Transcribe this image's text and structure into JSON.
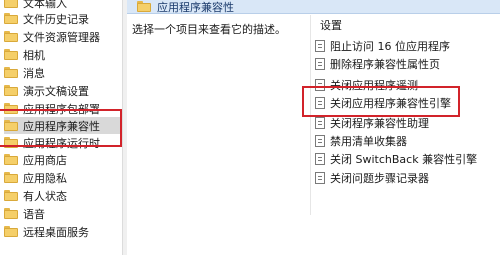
{
  "tree": {
    "items": [
      {
        "label": "文本输入"
      },
      {
        "label": "文件历史记录"
      },
      {
        "label": "文件资源管理器"
      },
      {
        "label": "相机"
      },
      {
        "label": "消息"
      },
      {
        "label": "演示文稿设置"
      },
      {
        "label": "应用程序包部署"
      },
      {
        "label": "应用程序兼容性",
        "selected": true
      },
      {
        "label": "应用程序运行时"
      },
      {
        "label": "应用商店"
      },
      {
        "label": "应用隐私"
      },
      {
        "label": "有人状态"
      },
      {
        "label": "语音"
      },
      {
        "label": "远程桌面服务"
      }
    ]
  },
  "details": {
    "header_title": "应用程序兼容性",
    "description": "选择一个项目来查看它的描述。",
    "column_header": "设置",
    "settings": [
      {
        "label": "阻止访问 16 位应用程序"
      },
      {
        "label": "删除程序兼容性属性页"
      },
      {
        "label": "关闭应用程序遥测"
      },
      {
        "label": "关闭应用程序兼容性引擎"
      },
      {
        "label": "关闭程序兼容性助理"
      },
      {
        "label": "禁用清单收集器"
      },
      {
        "label": "关闭 SwitchBack 兼容性引擎"
      },
      {
        "label": "关闭问题步骤记录器"
      }
    ]
  },
  "colors": {
    "highlight": "#d2232a",
    "header_bar": "#d9e7f7",
    "selected_bg": "#d9d9d9"
  },
  "icons": {
    "tree_item": "folder-icon",
    "setting_item": "policy-document-icon"
  }
}
